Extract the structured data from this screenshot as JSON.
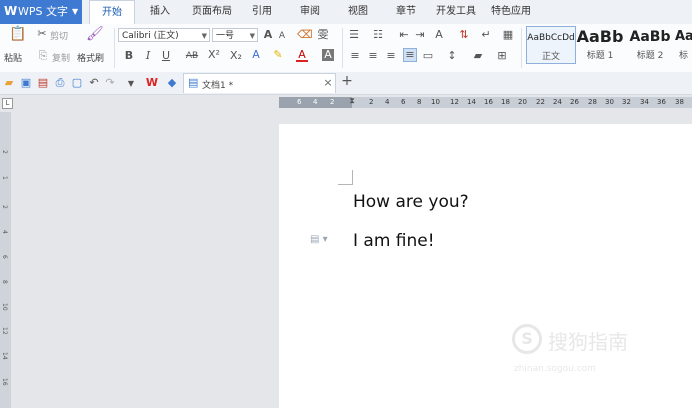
{
  "app": {
    "name": "WPS 文字"
  },
  "menu_tabs": [
    "开始",
    "插入",
    "页面布局",
    "引用",
    "审阅",
    "视图",
    "章节",
    "开发工具",
    "特色应用"
  ],
  "clipboard": {
    "paste": "粘贴",
    "cut": "剪切",
    "copy": "复制",
    "format_painter": "格式刷"
  },
  "font": {
    "name": "Calibri (正文)",
    "size": "一号",
    "bold": "B",
    "italic": "I",
    "underline": "U",
    "strike": "AB",
    "superscript": "X²",
    "subscript": "X₂",
    "grow": "A",
    "shrink": "A"
  },
  "styles": [
    {
      "preview": "AaBbCcDd",
      "name": "正文"
    },
    {
      "preview": "AaBb",
      "name": "标题 1"
    },
    {
      "preview": "AaBb",
      "name": "标题 2"
    },
    {
      "preview": "AaB",
      "name": "标"
    }
  ],
  "document_tab": {
    "title": "文档1 *",
    "close": "×",
    "new": "+"
  },
  "ruler": {
    "ticks": [
      "6",
      "4",
      "2",
      "2",
      "4",
      "6",
      "8",
      "10",
      "12",
      "14",
      "16",
      "18",
      "20",
      "22",
      "24",
      "26",
      "28",
      "30",
      "32",
      "34",
      "36",
      "38"
    ]
  },
  "vruler": {
    "ticks": [
      "2",
      "1",
      "2",
      "4",
      "6",
      "8",
      "10",
      "12",
      "14",
      "16"
    ]
  },
  "document": {
    "lines": [
      "How are you?",
      "I am fine!"
    ]
  },
  "watermark": {
    "text": "搜狗指南",
    "url": "zhinan.sogou.com"
  }
}
